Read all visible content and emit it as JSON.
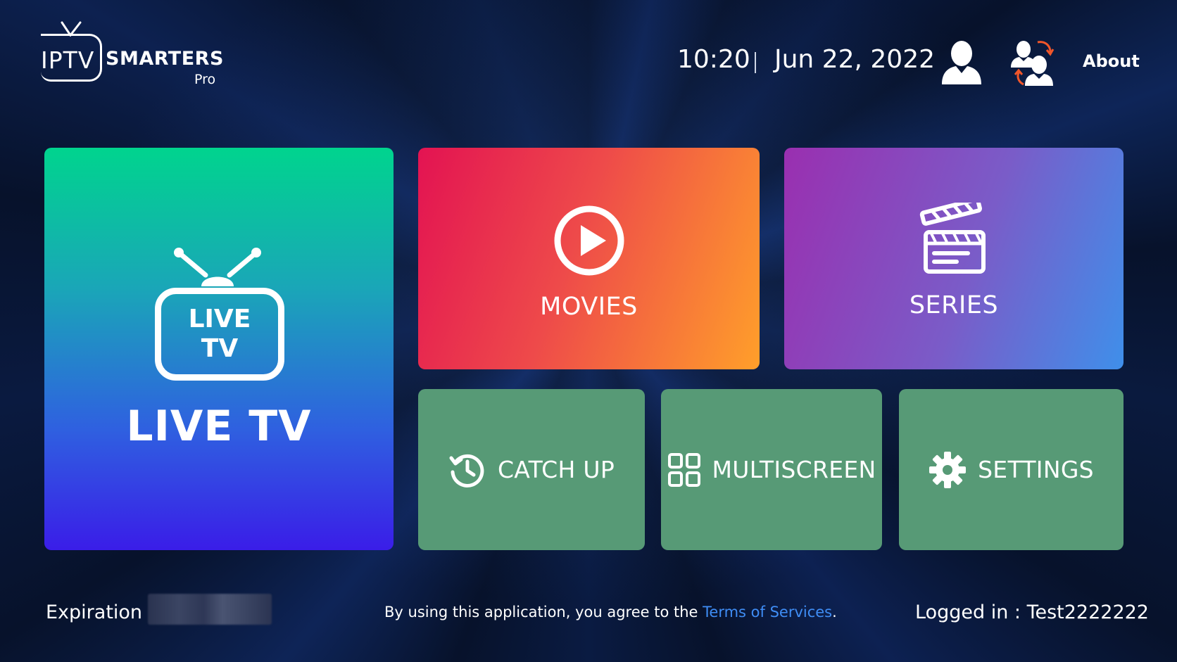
{
  "logo": {
    "iptv": "IPTV",
    "smarters": "SMARTERS",
    "pro": "Pro"
  },
  "header": {
    "time": "10:20",
    "date": "Jun 22, 2022",
    "about_label": "About"
  },
  "tiles": {
    "live_tv": {
      "label": "LIVE TV",
      "icon_line1": "LIVE",
      "icon_line2": "TV",
      "icon": "tv-icon"
    },
    "movies": {
      "label": "MOVIES",
      "icon": "play-icon"
    },
    "series": {
      "label": "SERIES",
      "icon": "clapperboard-icon"
    },
    "catch_up": {
      "label": "CATCH UP",
      "icon": "history-icon"
    },
    "multiscreen": {
      "label": "MULTISCREEN",
      "icon": "grid-icon"
    },
    "settings": {
      "label": "SETTINGS",
      "icon": "gear-icon"
    }
  },
  "footer": {
    "expiration_label": "Expiration :",
    "terms_prefix": "By using this application, you agree to the ",
    "terms_link": "Terms of Services",
    "terms_suffix": ".",
    "logged_in": "Logged in : Test2222222"
  },
  "colors": {
    "small_tile": "#579a76",
    "link": "#3f8df5",
    "switch_arrows": "#f0562a"
  }
}
